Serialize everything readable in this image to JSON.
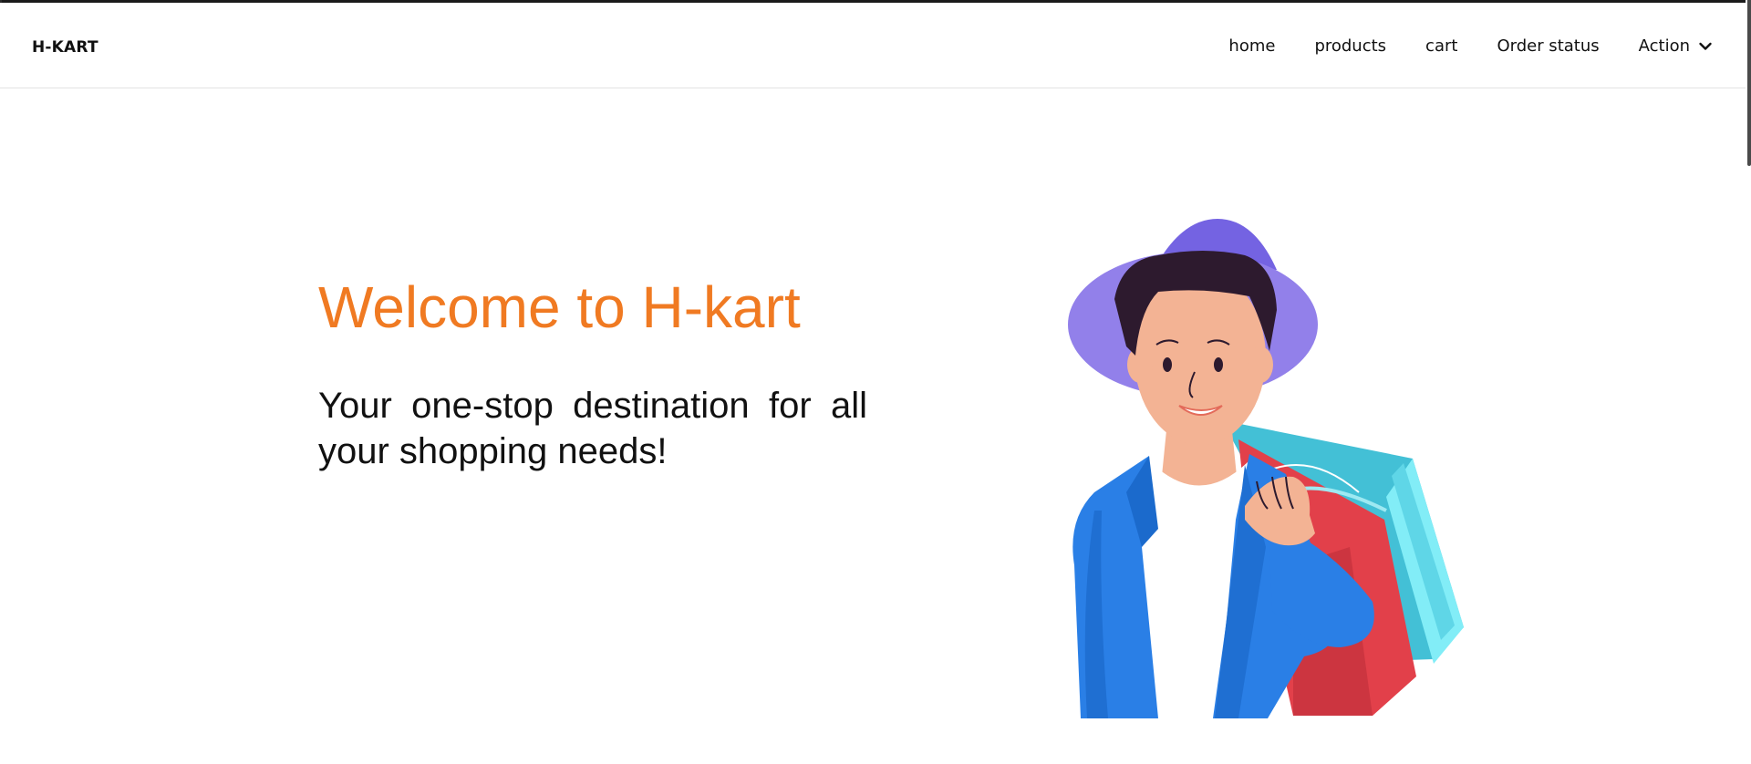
{
  "header": {
    "brand": "H-KART"
  },
  "nav": {
    "items": [
      {
        "label": "home"
      },
      {
        "label": "products"
      },
      {
        "label": "cart"
      },
      {
        "label": "Order status"
      }
    ],
    "dropdown_label": "Action",
    "dropdown_icon": "chevron-down-icon"
  },
  "hero": {
    "title": "Welcome to H-kart",
    "subtitle": "Your one-stop destination for all your shopping needs!",
    "illustration": "shopper-with-bags-illustration"
  },
  "colors": {
    "accent": "#f07a22",
    "text": "#111111",
    "hat": "#9280ea",
    "jacket": "#2a7fe6",
    "bag_red": "#e2404a",
    "bag_cyan": "#7fe9f5"
  }
}
